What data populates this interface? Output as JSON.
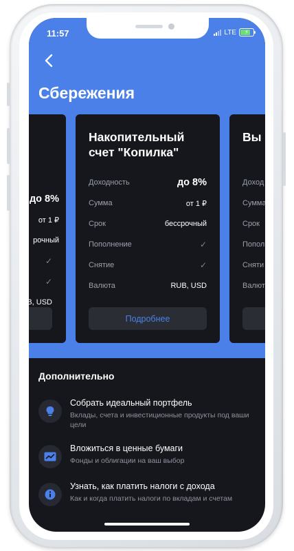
{
  "status": {
    "time": "11:57",
    "network": "LTE"
  },
  "page": {
    "title": "Сбережения"
  },
  "cards": {
    "left": {
      "title": "",
      "rows": [
        {
          "value": "до 8%"
        },
        {
          "value": "от 1 ₽"
        },
        {
          "value": "рочный"
        },
        {
          "value": "✓"
        },
        {
          "value": "✓"
        },
        {
          "value": "B, USD"
        }
      ]
    },
    "main": {
      "title": "Накопительный счет \"Копилка\"",
      "rows": [
        {
          "label": "Доходность",
          "value": "до 8%"
        },
        {
          "label": "Сумма",
          "value": "от 1 ₽"
        },
        {
          "label": "Срок",
          "value": "бессрочный"
        },
        {
          "label": "Пополнение",
          "value": "✓"
        },
        {
          "label": "Снятие",
          "value": "✓"
        },
        {
          "label": "Валюта",
          "value": "RUB, USD"
        }
      ],
      "button": "Подробнее"
    },
    "right": {
      "title": "Вы",
      "rows": [
        {
          "label": "Доход"
        },
        {
          "label": "Сумма"
        },
        {
          "label": "Срок"
        },
        {
          "label": "Попол"
        },
        {
          "label": "Сняти"
        },
        {
          "label": "Валют"
        }
      ]
    }
  },
  "extra": {
    "title": "Дополнительно",
    "items": [
      {
        "icon": "lightbulb-icon",
        "title": "Собрать идеальный портфель",
        "subtitle": "Вклады, счета и инвестиционные продукты под ваши цели"
      },
      {
        "icon": "chart-icon",
        "title": "Вложиться в ценные бумаги",
        "subtitle": "Фонды и облигации на ваш выбор"
      },
      {
        "icon": "info-icon",
        "title": "Узнать, как платить налоги с дохода",
        "subtitle": "Как и когда платить налоги по вкладам и счетам"
      }
    ]
  },
  "colors": {
    "accent": "#4b80e8",
    "background": "#16171d",
    "card_button": "#2b2d35"
  }
}
